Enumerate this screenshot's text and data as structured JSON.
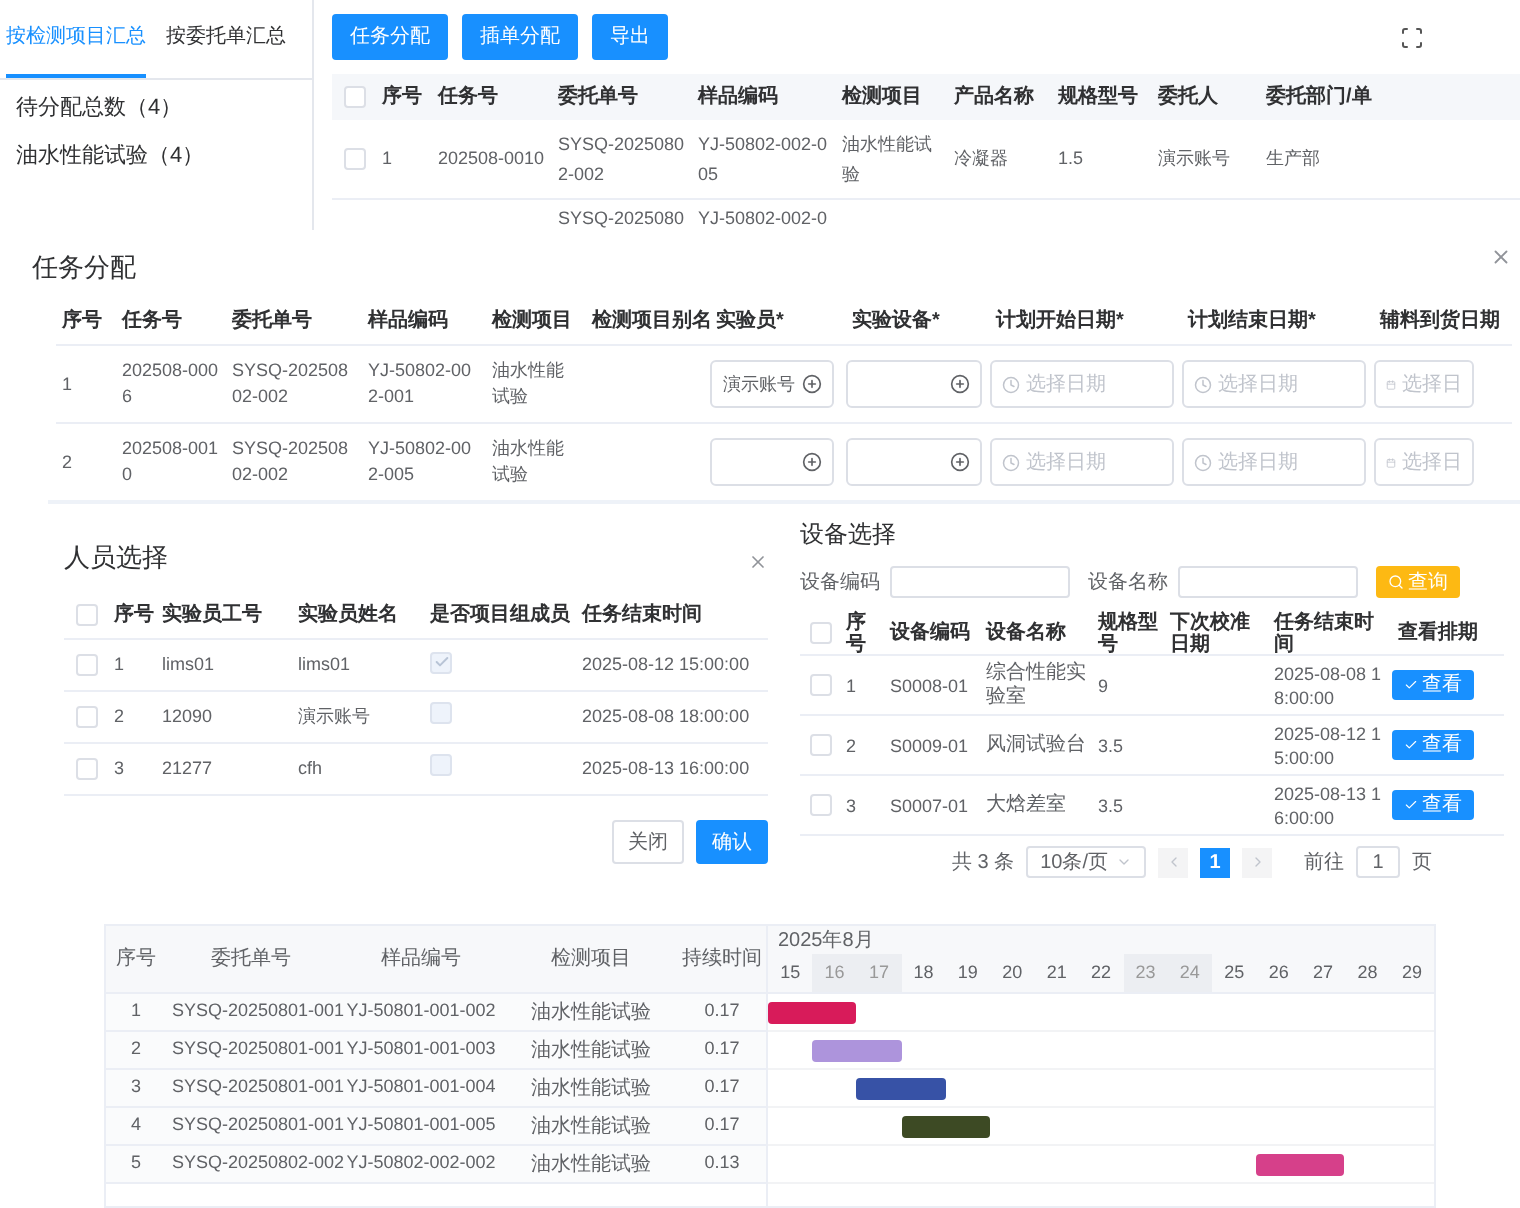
{
  "sidebar": {
    "tabs": [
      {
        "label": "按检测项目汇总",
        "selected": true
      },
      {
        "label": "按委托单汇总",
        "selected": false
      }
    ],
    "items": [
      "待分配总数（4）",
      "油水性能试验（4）"
    ]
  },
  "toolbar": {
    "buttons": [
      "任务分配",
      "插单分配",
      "导出"
    ]
  },
  "task_table": {
    "header_checked": false,
    "columns": [
      "序号",
      "任务号",
      "委托单号",
      "样品编码",
      "检测项目",
      "产品名称",
      "规格型号",
      "委托人",
      "委托部门/单"
    ],
    "rows": [
      {
        "checked": false,
        "cells": [
          "1",
          "202508-0010",
          "SYSQ-20250802-002",
          "YJ-50802-002-005",
          "油水性能试验",
          "冷凝器",
          "1.5",
          "演示账号",
          "生产部"
        ]
      }
    ],
    "partial_row": {
      "order_no": "SYSQ-2025080",
      "sample_code": "YJ-50802-002-0"
    }
  },
  "assign_dialog": {
    "title": "任务分配",
    "columns": [
      "序号",
      "任务号",
      "委托单号",
      "样品编码",
      "检测项目",
      "检测项目别名",
      "实验员*",
      "实验设备*",
      "计划开始日期*",
      "计划结束日期*",
      "辅料到货日期"
    ],
    "rows": [
      {
        "cells": [
          "1",
          "202508-0006",
          "SYSQ-20250802-002",
          "YJ-50802-002-001",
          "油水性能试验"
        ],
        "tester": "演示账号",
        "start_placeholder": "选择日期",
        "end_placeholder": "选择日期",
        "arrival_placeholder": "选择日"
      },
      {
        "cells": [
          "2",
          "202508-0010",
          "SYSQ-20250802-002",
          "YJ-50802-002-005",
          "油水性能试验"
        ],
        "start_placeholder": "选择日期",
        "end_placeholder": "选择日期",
        "arrival_placeholder": "选择日"
      }
    ]
  },
  "person_dialog": {
    "title": "人员选择",
    "header_checked": false,
    "columns": [
      "序号",
      "实验员工号",
      "实验员姓名",
      "是否项目组成员",
      "任务结束时间"
    ],
    "rows": [
      {
        "checked": false,
        "no": "1",
        "id": "lims01",
        "name": "lims01",
        "member": true,
        "end_time": "2025-08-12 15:00:00"
      },
      {
        "checked": false,
        "no": "2",
        "id": "12090",
        "name": "演示账号",
        "member": false,
        "end_time": "2025-08-08 18:00:00"
      },
      {
        "checked": false,
        "no": "3",
        "id": "21277",
        "name": "cfh",
        "member": false,
        "end_time": "2025-08-13 16:00:00"
      }
    ],
    "buttons": [
      {
        "label": "关闭",
        "primary": false
      },
      {
        "label": "确认",
        "primary": true
      }
    ]
  },
  "device_dialog": {
    "title": "设备选择",
    "filters": [
      "设备编码",
      "设备名称"
    ],
    "search_button": "查询",
    "header_checked": false,
    "columns": [
      "序号",
      "设备编码",
      "设备名称",
      "规格型号",
      "下次校准日期",
      "任务结束时间",
      "查看排期"
    ],
    "rows": [
      {
        "checked": false,
        "no": "1",
        "code": "S0008-01",
        "name": "综合性能实验室",
        "spec": "9",
        "end_time": "2025-08-08 18:00:00",
        "action": "查看"
      },
      {
        "checked": false,
        "no": "2",
        "code": "S0009-01",
        "name": "风洞试验台",
        "spec": "3.5",
        "end_time": "2025-08-12 15:00:00",
        "action": "查看"
      },
      {
        "checked": false,
        "no": "3",
        "code": "S0007-01",
        "name": "大焓差室",
        "spec": "3.5",
        "end_time": "2025-08-13 16:00:00",
        "action": "查看"
      }
    ],
    "pagination": {
      "total": "共 3 条",
      "page_size": "10条/页",
      "pages": [
        {
          "label": "1",
          "selected": true
        }
      ],
      "goto_label": "前往",
      "goto_value": "1",
      "goto_suffix": "页"
    }
  },
  "gantt": {
    "columns": [
      "序号",
      "委托单号",
      "样品编号",
      "检测项目",
      "持续时间"
    ],
    "month": "2025年8月",
    "days": [
      {
        "label": "15",
        "weekend": false
      },
      {
        "label": "16",
        "weekend": true
      },
      {
        "label": "17",
        "weekend": true
      },
      {
        "label": "18",
        "weekend": false
      },
      {
        "label": "19",
        "weekend": false
      },
      {
        "label": "20",
        "weekend": false
      },
      {
        "label": "21",
        "weekend": false
      },
      {
        "label": "22",
        "weekend": false
      },
      {
        "label": "23",
        "weekend": true
      },
      {
        "label": "24",
        "weekend": true
      },
      {
        "label": "25",
        "weekend": false
      },
      {
        "label": "26",
        "weekend": false
      },
      {
        "label": "27",
        "weekend": false
      },
      {
        "label": "28",
        "weekend": false
      },
      {
        "label": "29",
        "weekend": false
      }
    ],
    "rows": [
      {
        "cells": [
          "1",
          "SYSQ-20250801-001",
          "YJ-50801-001-002",
          "油水性能试验",
          "0.17"
        ],
        "color": "#d81b5a",
        "active": [
          true,
          true,
          false,
          false,
          false,
          false,
          false,
          false,
          false,
          false,
          false,
          false,
          false,
          false,
          false
        ]
      },
      {
        "cells": [
          "2",
          "SYSQ-20250801-001",
          "YJ-50801-001-003",
          "油水性能试验",
          "0.17"
        ],
        "color": "#ad94dc",
        "active": [
          false,
          true,
          true,
          false,
          false,
          false,
          false,
          false,
          false,
          false,
          false,
          false,
          false,
          false,
          false
        ]
      },
      {
        "cells": [
          "3",
          "SYSQ-20250801-001",
          "YJ-50801-001-004",
          "油水性能试验",
          "0.17"
        ],
        "color": "#3752a6",
        "active": [
          false,
          false,
          true,
          true,
          false,
          false,
          false,
          false,
          false,
          false,
          false,
          false,
          false,
          false,
          false
        ]
      },
      {
        "cells": [
          "4",
          "SYSQ-20250801-001",
          "YJ-50801-001-005",
          "油水性能试验",
          "0.17"
        ],
        "color": "#3d4a24",
        "active": [
          false,
          false,
          false,
          true,
          true,
          false,
          false,
          false,
          false,
          false,
          false,
          false,
          false,
          false,
          false
        ]
      },
      {
        "cells": [
          "5",
          "SYSQ-20250802-002",
          "YJ-50802-002-002",
          "油水性能试验",
          "0.13"
        ],
        "color": "#d6408a",
        "active": [
          false,
          false,
          false,
          false,
          false,
          false,
          false,
          false,
          false,
          false,
          false,
          true,
          true,
          false,
          false
        ]
      }
    ]
  }
}
